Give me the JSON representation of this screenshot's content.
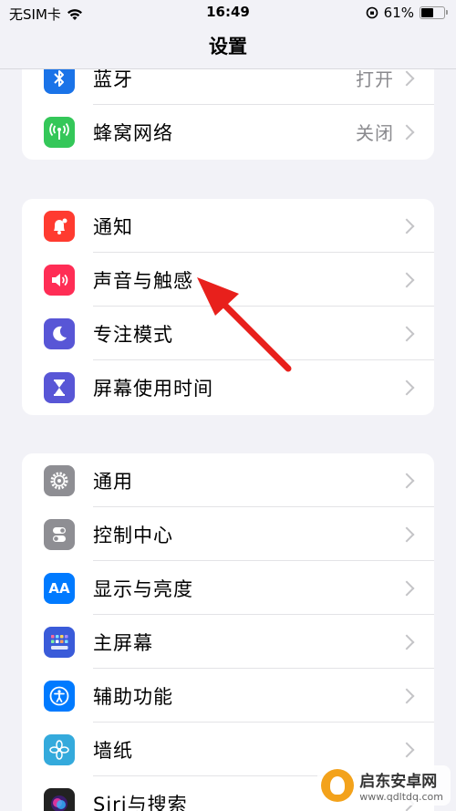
{
  "status_bar": {
    "carrier": "无SIM卡",
    "time": "16:49",
    "battery": "61%",
    "battery_level": 0.61
  },
  "title": "设置",
  "group1": [
    {
      "label": "蓝牙",
      "value": "打开",
      "icon": "bluetooth-icon",
      "color": "#1a73e8"
    },
    {
      "label": "蜂窝网络",
      "value": "关闭",
      "icon": "cellular-icon",
      "color": "#34c759"
    }
  ],
  "group2": [
    {
      "label": "通知",
      "icon": "bell-icon",
      "color": "#ff3b30"
    },
    {
      "label": "声音与触感",
      "icon": "speaker-icon",
      "color": "#ff2d55"
    },
    {
      "label": "专注模式",
      "icon": "moon-icon",
      "color": "#5856d6"
    },
    {
      "label": "屏幕使用时间",
      "icon": "hourglass-icon",
      "color": "#5856d6"
    }
  ],
  "group3": [
    {
      "label": "通用",
      "icon": "gear-icon",
      "color": "#8e8e93"
    },
    {
      "label": "控制中心",
      "icon": "toggle-icon",
      "color": "#8e8e93"
    },
    {
      "label": "显示与亮度",
      "icon": "aa-icon",
      "color": "#007aff"
    },
    {
      "label": "主屏幕",
      "icon": "home-grid-icon",
      "color": "#3a5bd9"
    },
    {
      "label": "辅助功能",
      "icon": "accessibility-icon",
      "color": "#007aff"
    },
    {
      "label": "墙纸",
      "icon": "flower-icon",
      "color": "#34aadc"
    },
    {
      "label": "Siri与搜索",
      "icon": "siri-icon",
      "color": "#222"
    }
  ],
  "icon_text": {
    "aa": "AA"
  },
  "watermark": {
    "name": "启东安卓网",
    "url": "www.qdltdq.com"
  }
}
